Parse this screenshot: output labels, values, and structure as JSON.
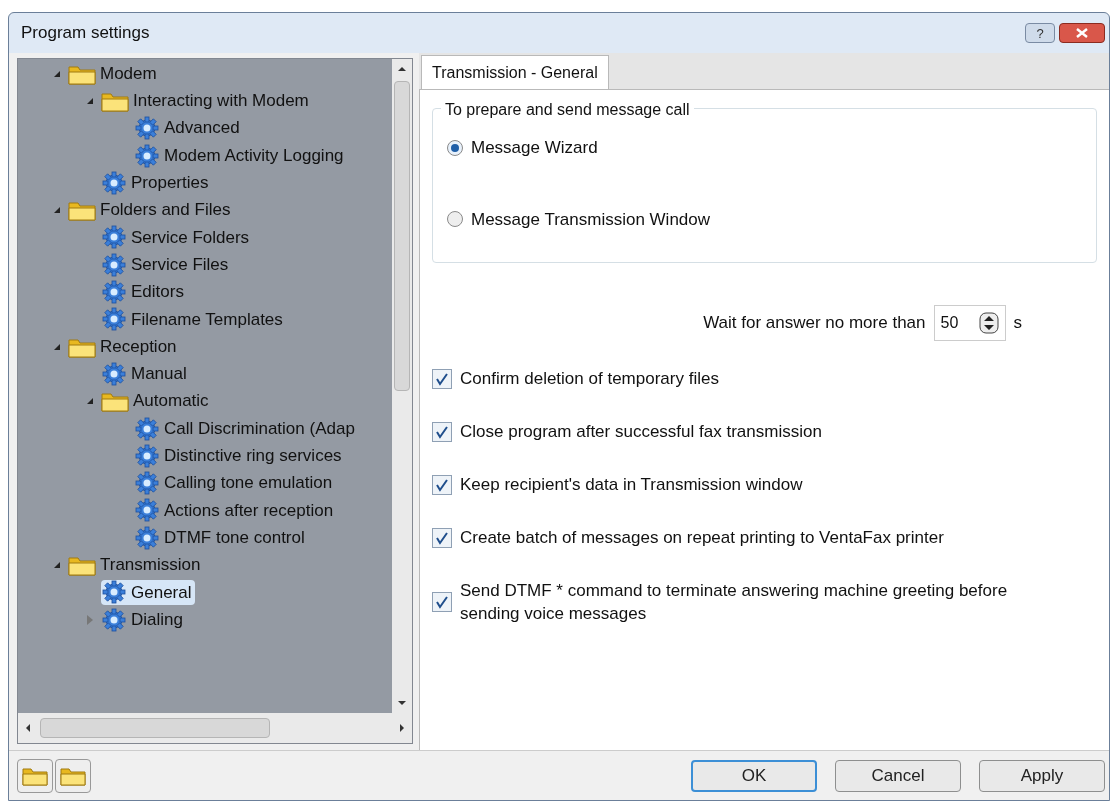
{
  "window": {
    "title": "Program settings",
    "help_button": "?"
  },
  "tree": [
    {
      "label": "Modem",
      "kind": "folder",
      "expanded": true,
      "selected": false,
      "children": [
        {
          "label": "Interacting with Modem",
          "kind": "folder",
          "expanded": true,
          "selected": false,
          "children": [
            {
              "label": "Advanced",
              "kind": "page",
              "selected": false
            },
            {
              "label": "Modem Activity Logging",
              "kind": "page",
              "selected": false
            }
          ]
        },
        {
          "label": "Properties",
          "kind": "page",
          "selected": false
        }
      ]
    },
    {
      "label": "Folders and Files",
      "kind": "folder",
      "expanded": true,
      "selected": false,
      "children": [
        {
          "label": "Service Folders",
          "kind": "page",
          "selected": false
        },
        {
          "label": "Service Files",
          "kind": "page",
          "selected": false
        },
        {
          "label": "Editors",
          "kind": "page",
          "selected": false
        },
        {
          "label": "Filename Templates",
          "kind": "page",
          "selected": false
        }
      ]
    },
    {
      "label": "Reception",
      "kind": "folder",
      "expanded": true,
      "selected": false,
      "children": [
        {
          "label": "Manual",
          "kind": "page",
          "selected": false
        },
        {
          "label": "Automatic",
          "kind": "folder",
          "expanded": true,
          "selected": false,
          "children": [
            {
              "label": "Call Discrimination (Adap",
              "kind": "page",
              "selected": false
            },
            {
              "label": "Distinctive ring services",
              "kind": "page",
              "selected": false
            },
            {
              "label": "Calling tone emulation",
              "kind": "page",
              "selected": false
            },
            {
              "label": "Actions after reception",
              "kind": "page",
              "selected": false
            },
            {
              "label": "DTMF tone control",
              "kind": "page",
              "selected": false
            }
          ]
        }
      ]
    },
    {
      "label": "Transmission",
      "kind": "folder",
      "expanded": true,
      "selected": false,
      "children": [
        {
          "label": "General",
          "kind": "page",
          "selected": true
        },
        {
          "label": "Dialing",
          "kind": "page",
          "expanded": false,
          "selected": false
        }
      ]
    }
  ],
  "tab": {
    "label": "Transmission - General"
  },
  "group": {
    "title": "To prepare and send message call",
    "options": [
      {
        "label": "Message Wizard",
        "selected": true
      },
      {
        "label": "Message Transmission Window",
        "selected": false
      }
    ]
  },
  "wait": {
    "label": "Wait for answer no more than",
    "value": "50",
    "unit": "s"
  },
  "checkboxes": [
    {
      "label": "Confirm deletion of temporary files",
      "checked": true
    },
    {
      "label": "Close program after successful fax transmission",
      "checked": true
    },
    {
      "label": "Keep recipient's data in Transmission window",
      "checked": true
    },
    {
      "label": "Create batch of messages on repeat printing to VentaFax printer",
      "checked": true
    },
    {
      "label": "Send DTMF * command to terminate answering machine greeting before sending voice messages",
      "checked": true
    }
  ],
  "buttons": [
    {
      "label": "OK",
      "default": true
    },
    {
      "label": "Cancel",
      "default": false
    },
    {
      "label": "Apply",
      "default": false
    }
  ]
}
